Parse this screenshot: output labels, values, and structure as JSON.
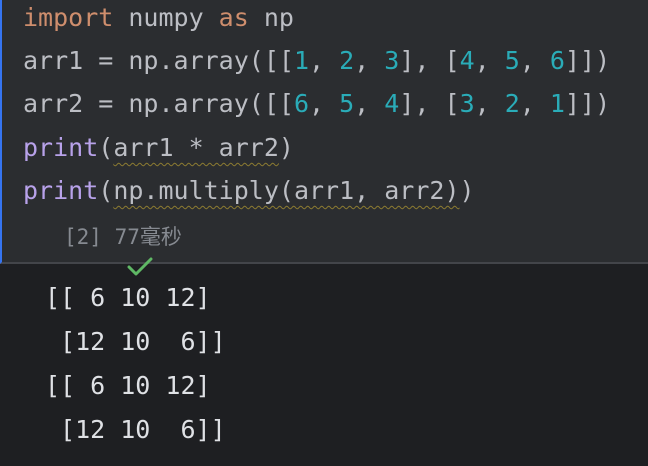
{
  "code": {
    "line1": {
      "kw_import": "import",
      "mod": " numpy ",
      "kw_as": "as",
      "alias": " np"
    },
    "line2": {
      "lhs": "arr1 = np.array([[",
      "n1": "1",
      "c1": ", ",
      "n2": "2",
      "c2": ", ",
      "n3": "3",
      "mid": "], [",
      "n4": "4",
      "c3": ", ",
      "n5": "5",
      "c4": ", ",
      "n6": "6",
      "end": "]])"
    },
    "line3": {
      "lhs": "arr2 = np.array([[",
      "n1": "6",
      "c1": ", ",
      "n2": "5",
      "c2": ", ",
      "n3": "4",
      "mid": "], [",
      "n4": "3",
      "c3": ", ",
      "n5": "2",
      "c4": ", ",
      "n6": "1",
      "end": "]])"
    },
    "line4": {
      "fn": "print",
      "open": "(",
      "arg": "arr1 * arr2",
      "close": ")"
    },
    "line5": {
      "fn": "print",
      "open": "(",
      "arg": "np.multiply(arr1, arr2)",
      "close": ")"
    }
  },
  "status": {
    "icon": "check-icon",
    "icon_color": "#5fb865",
    "exec_count": "[2]",
    "duration": "77毫秒"
  },
  "output": {
    "lines": [
      "[[ 6 10 12]",
      " [12 10  6]]",
      "[[ 6 10 12]",
      " [12 10  6]]"
    ]
  }
}
